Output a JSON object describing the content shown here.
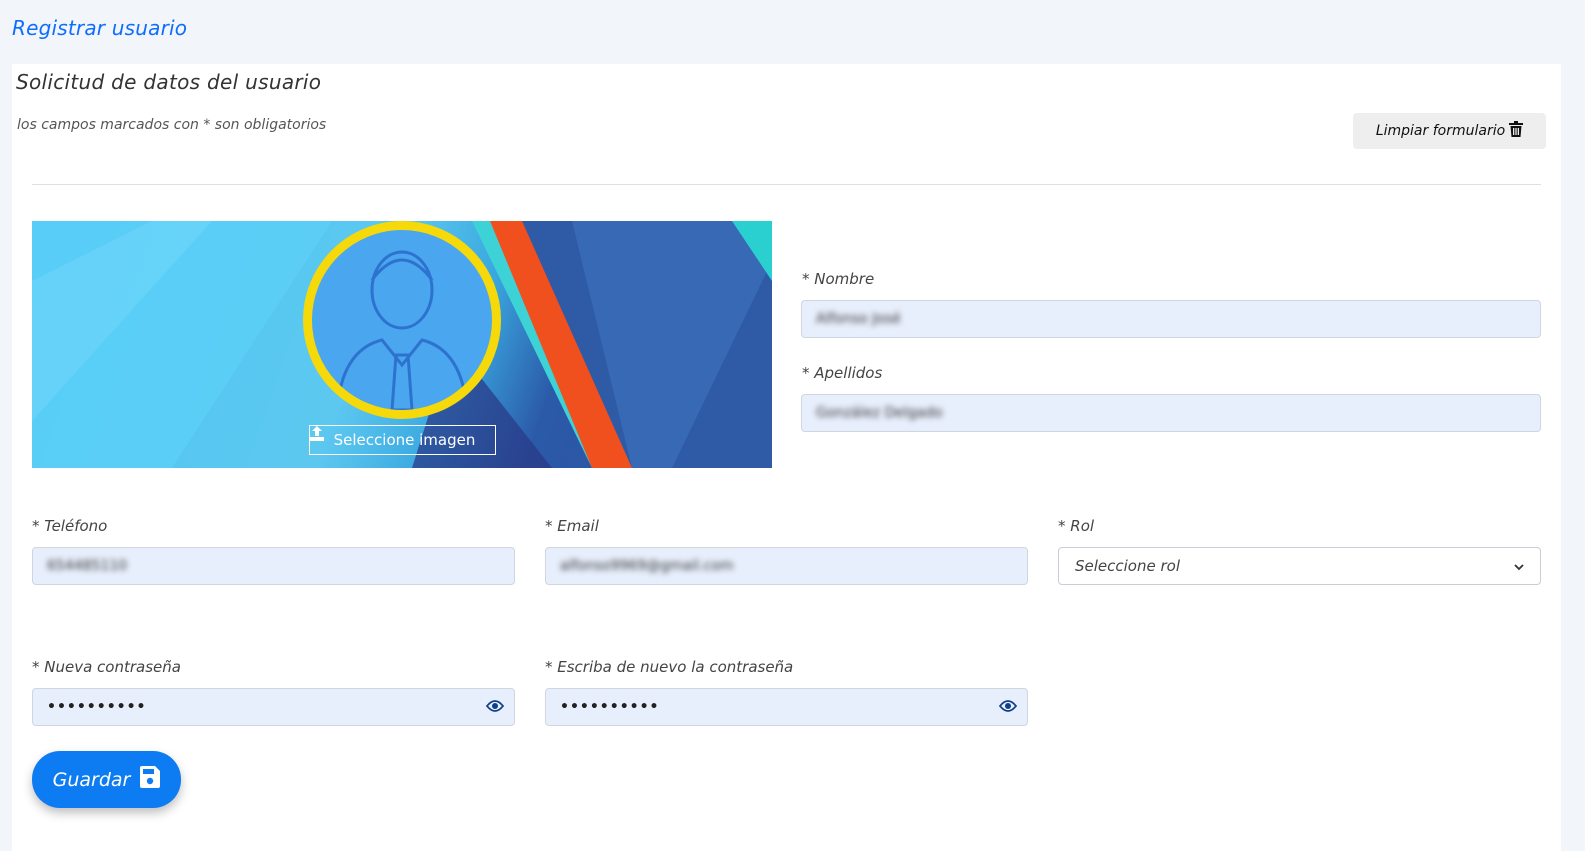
{
  "page_title": "Registrar usuario",
  "form": {
    "title": "Solicitud de datos del usuario",
    "required_note": "los campos marcados con * son obligatorios",
    "clear_label": "Limpiar formulario",
    "upload_label": "Seleccione imagen",
    "fields": {
      "nombre": {
        "label": "* Nombre",
        "value": "Alfonso José"
      },
      "apellidos": {
        "label": "* Apellidos",
        "value": "González Delgado"
      },
      "telefono": {
        "label": "* Teléfono",
        "value": "654485110"
      },
      "email": {
        "label": "* Email",
        "value": "alfonso9969@gmail.com"
      },
      "rol": {
        "label": "* Rol",
        "selected": "Seleccione rol"
      },
      "password": {
        "label": "* Nueva contraseña",
        "value": "••••••••••"
      },
      "password_repeat": {
        "label": "* Escriba de nuevo la contraseña",
        "value": "••••••••••"
      }
    },
    "save_label": "Guardar"
  },
  "colors": {
    "accent": "#0d6efd",
    "save_button": "#0d7cf2",
    "input_bg": "#e8effc",
    "avatar_ring": "#f5d90a"
  },
  "icons": [
    "trash-icon",
    "upload-icon",
    "user-icon",
    "eye-icon",
    "save-icon",
    "chevron-down-icon"
  ]
}
